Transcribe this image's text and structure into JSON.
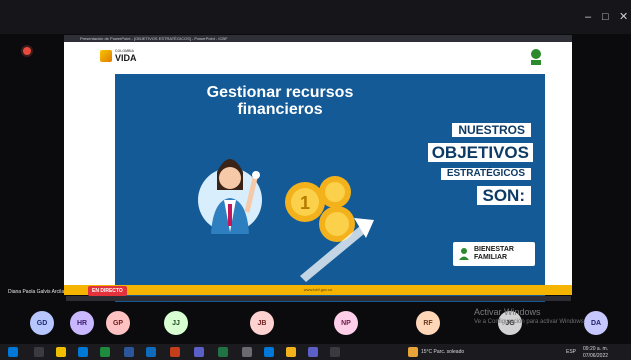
{
  "window": {
    "controls": [
      "–",
      "□",
      "✕"
    ]
  },
  "share": {
    "tab_title": "Presentación de PowerPoint - [OBJETIVOS ESTRATÉGICOS] - PowerPoint - ICBF"
  },
  "slide": {
    "logo_small_text": "COLOMBIA",
    "logo_big_text": "VIDA",
    "heading": "Gestionar recursos financieros",
    "objective_lines": [
      "NUESTROS",
      "OBJETIVOS",
      "ESTRATÉGICOS",
      "SON:"
    ],
    "brand_badge_line1": "BIENESTAR",
    "brand_badge_line2": "FAMILIAR",
    "footer_text": "www.icbf.gov.co"
  },
  "presenter": {
    "name": "Diana Paola Galvis Arcila",
    "live_badge": "EN DIRECTO"
  },
  "participants": [
    {
      "initials": "GD",
      "color": "#b7c6ff"
    },
    {
      "initials": "HR",
      "color": "#c9b7ff"
    },
    {
      "initials": "GP",
      "color": "#ffc2c2"
    },
    {
      "initials": "JJ",
      "color": "#d8ffd2"
    },
    {
      "initials": "JB",
      "color": "#ffd2d2"
    },
    {
      "initials": "NP",
      "color": "#ffcfea"
    },
    {
      "initials": "RF",
      "color": "#ffd6b8"
    },
    {
      "initials": "JG",
      "color": "#d2d2d2"
    },
    {
      "initials": "DA",
      "color": "#c7c7ff"
    }
  ],
  "windows_activation": {
    "title": "Activar Windows",
    "subtitle": "Ve a Configuración para activar Windows."
  },
  "taskbar": {
    "weather": "15°C  Parc. soleado",
    "lang": "ESP",
    "time": "09:20 a. m.",
    "date": "07/06/2022"
  }
}
